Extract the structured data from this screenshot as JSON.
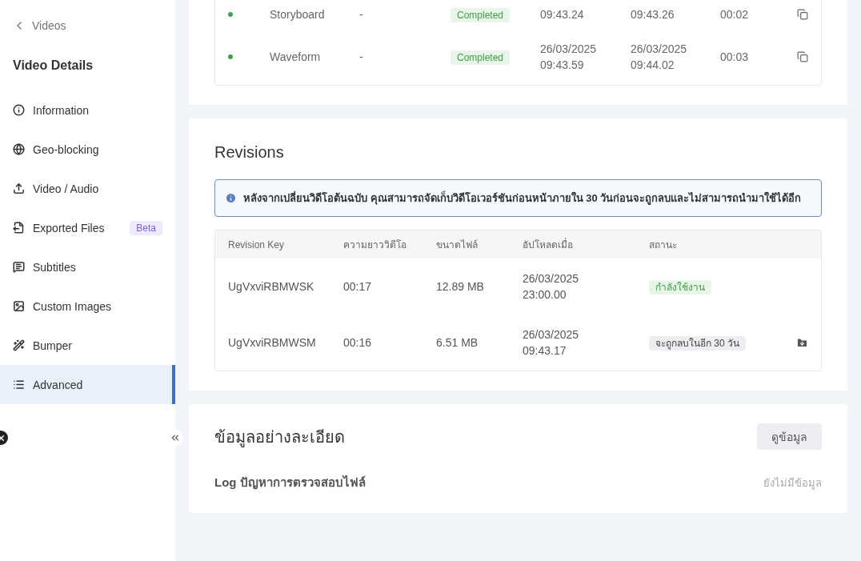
{
  "sidebar": {
    "back_link": "Videos",
    "title": "Video Details",
    "items": [
      {
        "label": "Information",
        "selected": false
      },
      {
        "label": "Geo-blocking",
        "selected": false
      },
      {
        "label": "Video / Audio",
        "selected": false
      },
      {
        "label": "Exported Files",
        "selected": false,
        "badge": "Beta"
      },
      {
        "label": "Subtitles",
        "selected": false
      },
      {
        "label": "Custom Images",
        "selected": false
      },
      {
        "label": "Bumper",
        "selected": false
      },
      {
        "label": "Advanced",
        "selected": true
      }
    ]
  },
  "jobs": {
    "rows": [
      {
        "name": "Storyboard",
        "detail": "-",
        "status": "Completed",
        "started": "09:43.24",
        "finished": "09:43.26",
        "duration": "00:02"
      },
      {
        "name": "Waveform",
        "detail": "-",
        "status": "Completed",
        "started": "26/03/2025\n09:43.59",
        "finished": "26/03/2025\n09:44.02",
        "duration": "00:03"
      }
    ]
  },
  "revisions": {
    "title": "Revisions",
    "notice": "หลังจากเปลี่ยนวิดีโอต้นฉบับ คุณสามารถจัดเก็บวิดีโอเวอร์ชันก่อนหน้าภายใน 30 วันก่อนจะถูกลบและไม่สามารถนำมาใช้ได้อีก",
    "columns": [
      "Revision Key",
      "ความยาววิดีโอ",
      "ขนาดไฟล์",
      "อัปโหลดเมื่อ",
      "สถานะ"
    ],
    "rows": [
      {
        "key": "UgVxviRBMWSK",
        "length": "00:17",
        "size": "12.89 MB",
        "uploaded": "26/03/2025\n23:00.00",
        "status": "กำลังใช้งาน",
        "kind": "active"
      },
      {
        "key": "UgVxviRBMWSM",
        "length": "00:16",
        "size": "6.51 MB",
        "uploaded": "26/03/2025\n09:43.17",
        "status": "จะถูกลบในอีก 30 วัน",
        "kind": "expiring"
      }
    ]
  },
  "details": {
    "title": "ข้อมูลอย่างละเอียด",
    "button": "ดูข้อมูล",
    "log_label": "Log ปัญหาการตรวจสอบไฟล์",
    "log_value": "ยังไม่มีข้อมูล"
  }
}
